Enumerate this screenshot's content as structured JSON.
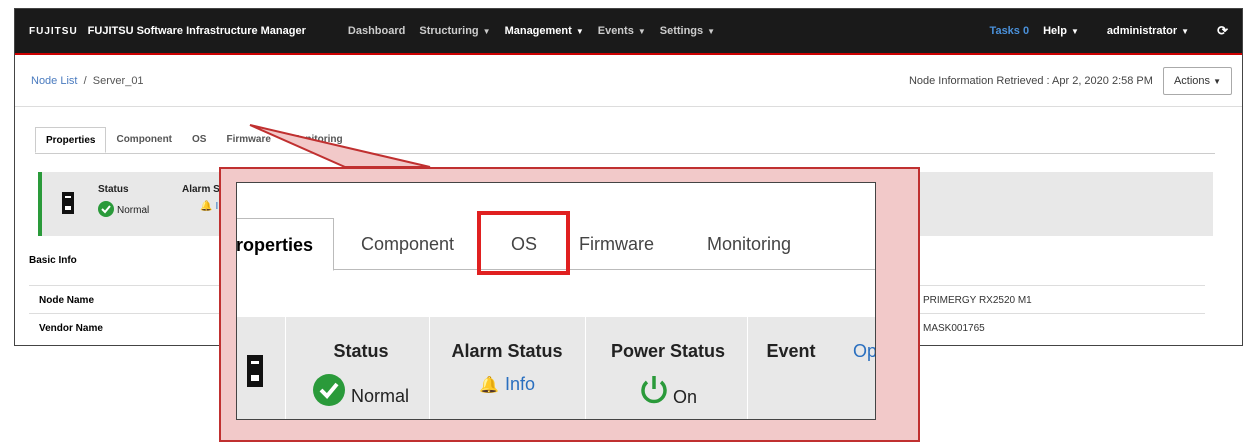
{
  "topbar": {
    "logo": "FUJITSU",
    "app_title": "FUJITSU Software Infrastructure Manager",
    "nav": [
      {
        "label": "Dashboard",
        "caret": false,
        "active": false
      },
      {
        "label": "Structuring",
        "caret": true,
        "active": false
      },
      {
        "label": "Management",
        "caret": true,
        "active": true
      },
      {
        "label": "Events",
        "caret": true,
        "active": false
      },
      {
        "label": "Settings",
        "caret": true,
        "active": false
      }
    ],
    "tasks": "Tasks 0",
    "help": "Help",
    "user": "administrator",
    "refresh_icon": "refresh-icon"
  },
  "breadcrumb": {
    "root": "Node List",
    "separator": "/",
    "current": "Server_01"
  },
  "retrieved": "Node Information Retrieved : Apr 2, 2020 2:58 PM",
  "actions_label": "Actions",
  "tabs": [
    "Properties",
    "Component",
    "OS",
    "Firmware",
    "Monitoring"
  ],
  "status_strip": {
    "status_label": "Status",
    "status_value": "Normal",
    "alarm_label": "Alarm S",
    "alarm_value": "I"
  },
  "basic_info_label": "Basic Info",
  "basic_rows": [
    {
      "key": "Node Name",
      "value": "PRIMERGY RX2520 M1"
    },
    {
      "key": "Vendor Name",
      "value": "MASK001765"
    }
  ],
  "zoom": {
    "tabs": [
      "roperties",
      "Component",
      "OS",
      "Firmware",
      "Monitoring"
    ],
    "status_label": "Status",
    "status_value": "Normal",
    "alarm_label": "Alarm Status",
    "alarm_value": "Info",
    "power_label": "Power Status",
    "power_value": "On",
    "event_label": "Event",
    "extra_label": "Op"
  },
  "colors": {
    "accent_red": "#e02020",
    "ok_green": "#2a9a3a",
    "link_blue": "#4a90d9"
  }
}
